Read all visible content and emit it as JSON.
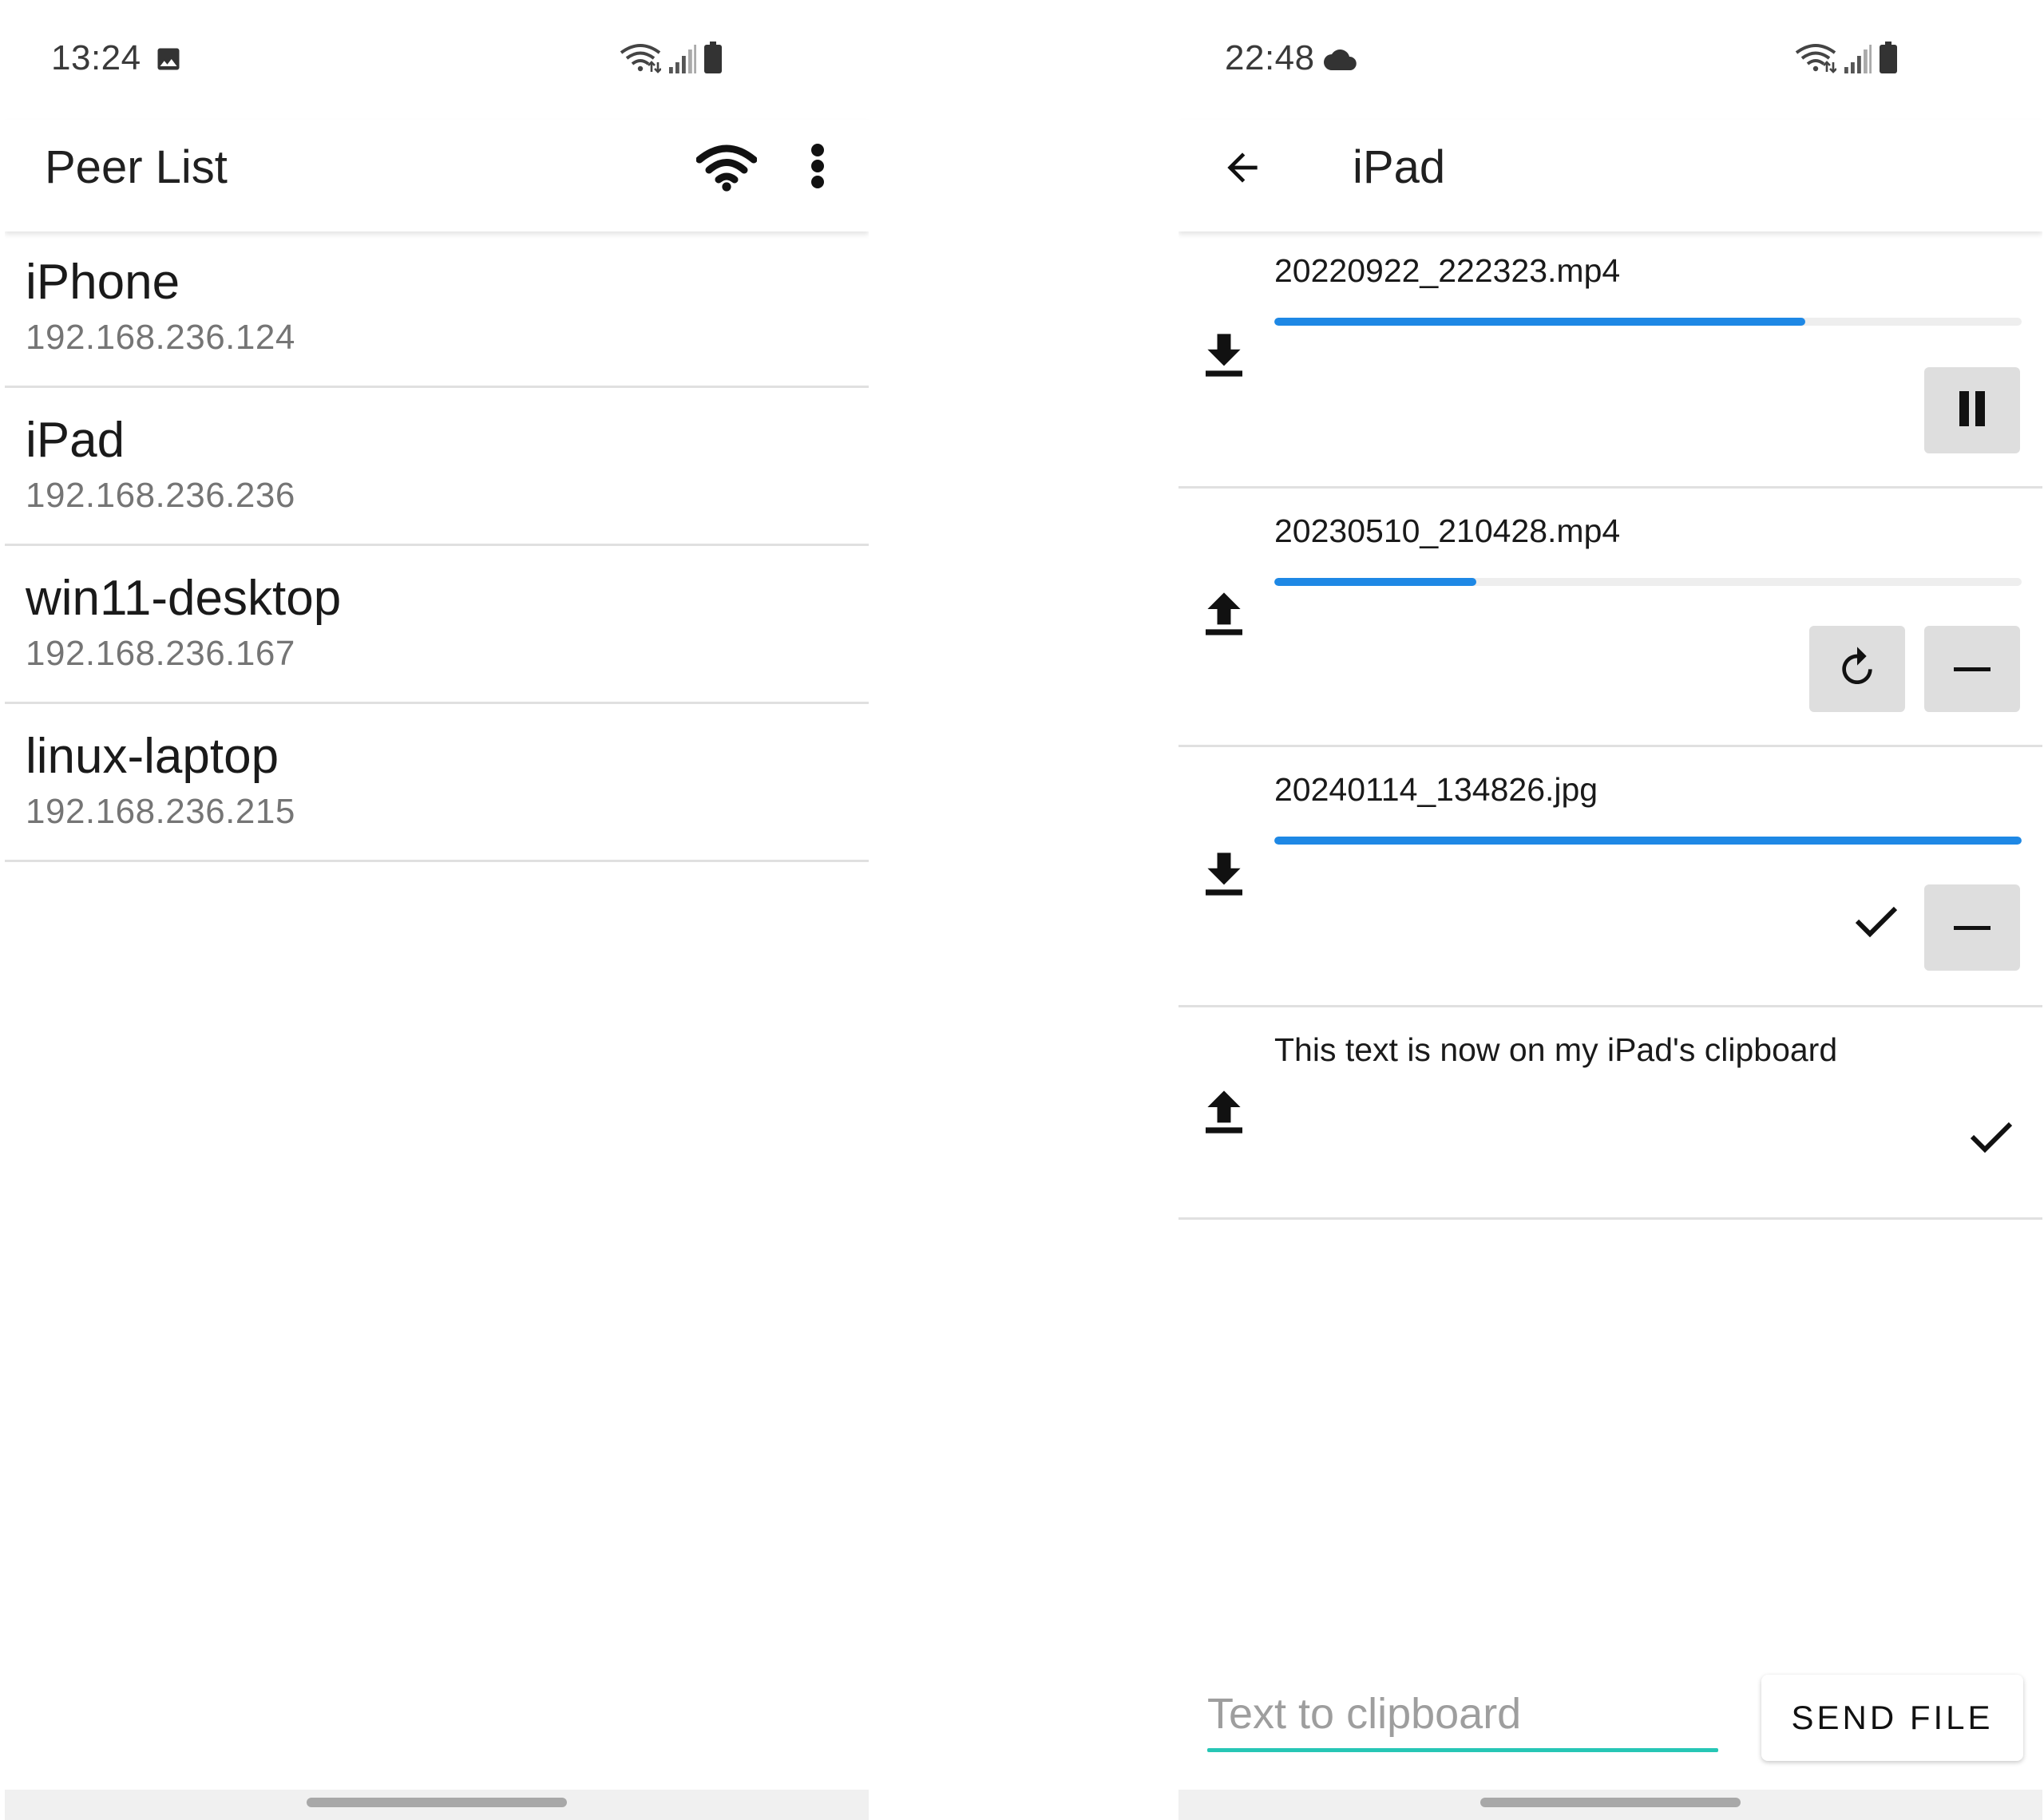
{
  "left_screen": {
    "status_bar": {
      "time": "13:24",
      "left_icon": "image-icon",
      "right_icons": [
        "wifi-data-icon",
        "signal-icon",
        "battery-icon"
      ]
    },
    "app_bar": {
      "title": "Peer List",
      "actions": [
        "wifi-icon",
        "more-vert-icon"
      ]
    },
    "peers": [
      {
        "name": "iPhone",
        "ip": "192.168.236.124"
      },
      {
        "name": "iPad",
        "ip": "192.168.236.236"
      },
      {
        "name": "win11-desktop",
        "ip": "192.168.236.167"
      },
      {
        "name": "linux-laptop",
        "ip": "192.168.236.215"
      }
    ]
  },
  "right_screen": {
    "status_bar": {
      "time": "22:48",
      "left_icon": "cloud-icon",
      "right_icons": [
        "wifi-data-icon",
        "signal-icon",
        "battery-icon"
      ]
    },
    "app_bar": {
      "title": "iPad",
      "back_icon": "arrow-back-icon"
    },
    "transfers": [
      {
        "name": "20220922_222323.mp4",
        "direction": "download",
        "progress": 0.71,
        "actions": [
          "pause"
        ]
      },
      {
        "name": "20230510_210428.mp4",
        "direction": "upload",
        "progress": 0.27,
        "actions": [
          "retry",
          "remove"
        ]
      },
      {
        "name": "20240114_134826.jpg",
        "direction": "download",
        "progress": 1.0,
        "status": "done",
        "actions": [
          "remove"
        ]
      },
      {
        "name": "This text is now on my iPad's clipboard",
        "direction": "upload",
        "status": "done",
        "actions": []
      }
    ],
    "clipboard_input": {
      "placeholder": "Text to clipboard",
      "value": ""
    },
    "send_file_label": "SEND FILE"
  },
  "colors": {
    "progress": "#1e88e5",
    "progress_track": "#eeeeee",
    "input_underline": "#26c6b5",
    "button_bg": "#dedede",
    "divider": "#e0e0e0"
  }
}
